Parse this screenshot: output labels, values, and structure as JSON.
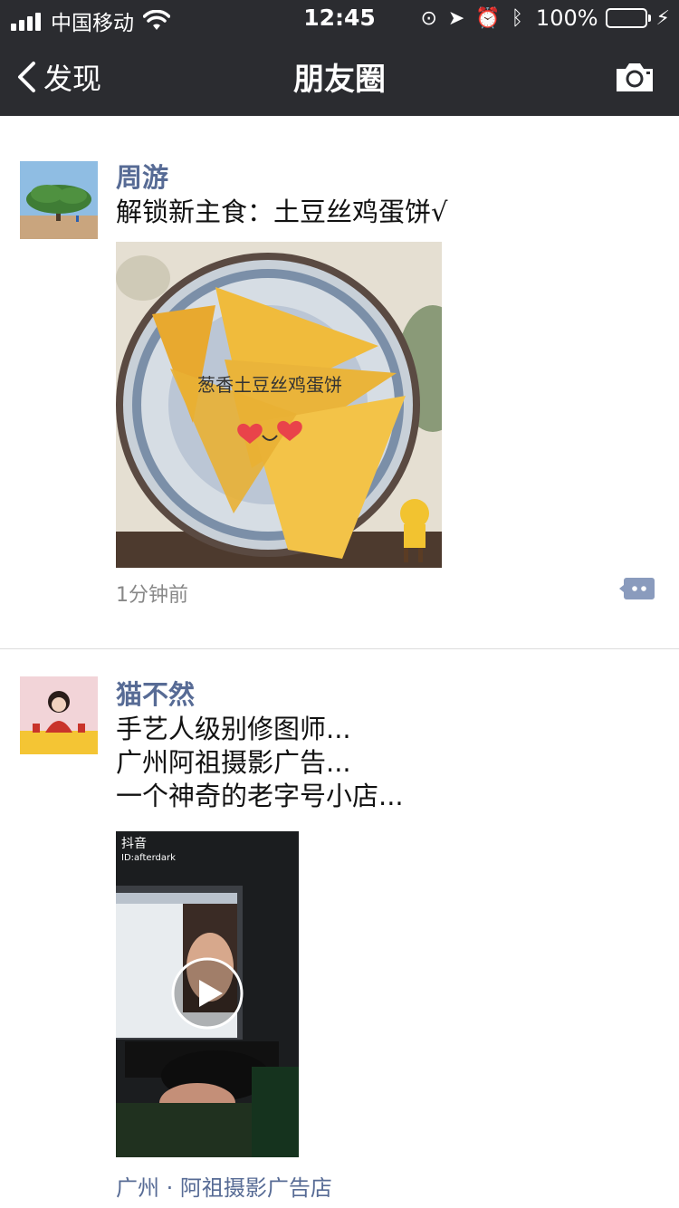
{
  "status_bar": {
    "carrier": "中国移动",
    "time": "12:45",
    "battery_percent": "100%",
    "battery_level": 1.0,
    "icons": [
      "signal-icon",
      "wifi-icon",
      "orientation-lock-icon",
      "location-icon",
      "alarm-icon",
      "bluetooth-icon",
      "battery-icon",
      "charging-icon"
    ]
  },
  "nav": {
    "back_label": "发现",
    "title": "朋友圈",
    "camera_icon": "camera-icon"
  },
  "posts": [
    {
      "username": "周游",
      "text": "解锁新主食：土豆丝鸡蛋饼√",
      "image_caption": "葱香土豆丝鸡蛋饼",
      "time": "1分钟前",
      "comment_icon": "comment-icon"
    },
    {
      "username": "猫不然",
      "text": "手艺人级别修图师...\n广州阿祖摄影广告...\n一个神奇的老字号小店...",
      "video_brand": "抖音",
      "video_id": "ID:afterdark",
      "location": "广州 · 阿祖摄影广告店"
    }
  ],
  "colors": {
    "nav_background": "#2b2c30",
    "username": "#576b95",
    "battery_fill": "#4cd964"
  }
}
